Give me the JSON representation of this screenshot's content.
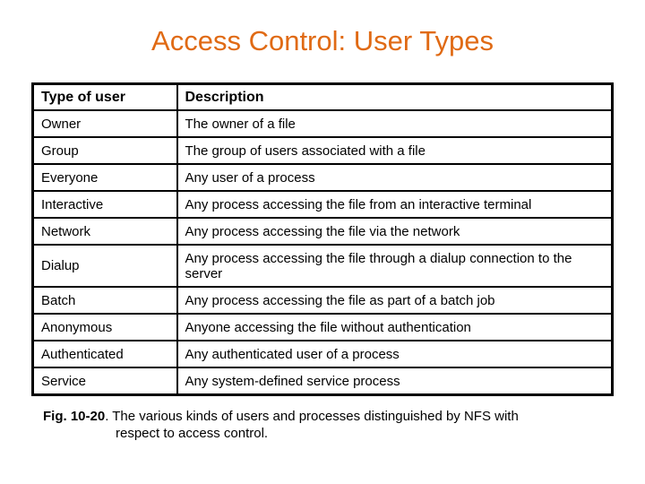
{
  "slide": {
    "title": "Access Control: User Types",
    "title_color": "#e06a14"
  },
  "table": {
    "headers": [
      "Type of user",
      "Description"
    ],
    "rows": [
      {
        "type": "Owner",
        "description": "The owner of a file"
      },
      {
        "type": "Group",
        "description": "The group of users associated with a file"
      },
      {
        "type": "Everyone",
        "description": "Any user of a process"
      },
      {
        "type": "Interactive",
        "description": "Any process accessing the file from an interactive terminal"
      },
      {
        "type": "Network",
        "description": "Any process accessing the file via the network"
      },
      {
        "type": "Dialup",
        "description": "Any process accessing the file through a dialup connection to the server"
      },
      {
        "type": "Batch",
        "description": "Any process accessing the file as part of a batch job"
      },
      {
        "type": "Anonymous",
        "description": "Anyone accessing the file without authentication"
      },
      {
        "type": "Authenticated",
        "description": "Any authenticated user of a process"
      },
      {
        "type": "Service",
        "description": "Any system-defined service process"
      }
    ]
  },
  "caption": {
    "label": "Fig. 10-20",
    "text_line1": ". The various kinds of users and processes distinguished by NFS with",
    "text_line2": "respect  to access control."
  }
}
